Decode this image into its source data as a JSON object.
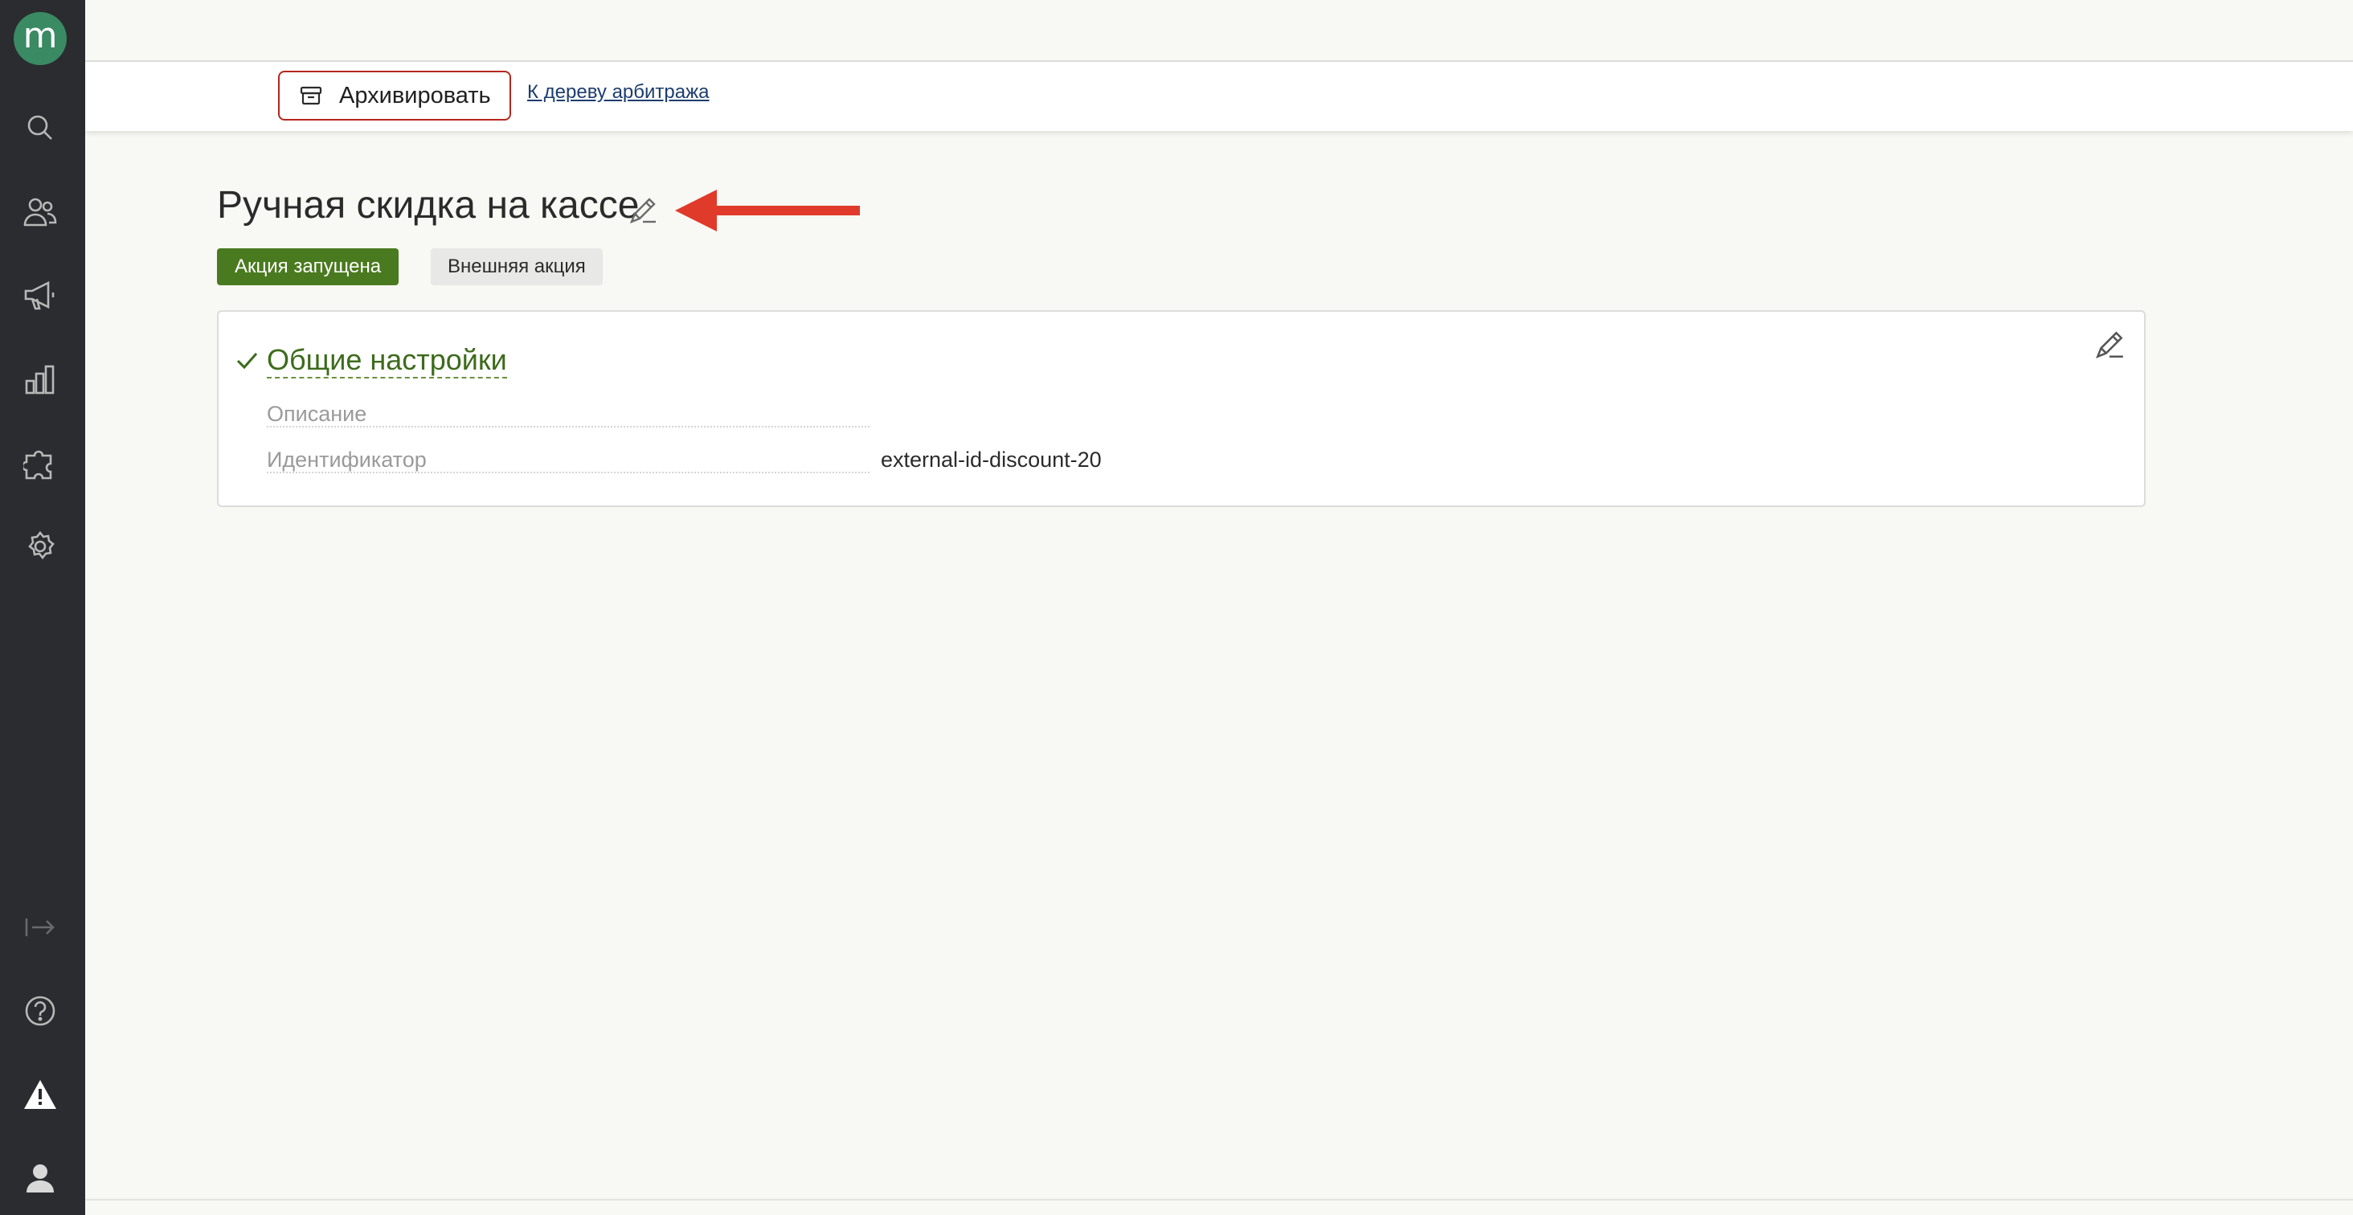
{
  "colors": {
    "sidebar_bg": "#2a2c30",
    "logo_bg": "#3a8a63",
    "active_badge": "#4a7a1f",
    "archive_border": "#b5261e",
    "section_title": "#3d6b1c",
    "arrow": "#e03a2a"
  },
  "sidebar": {
    "logo_letter": "m",
    "items": [
      {
        "icon": "search-icon"
      },
      {
        "icon": "users-icon"
      },
      {
        "icon": "megaphone-icon"
      },
      {
        "icon": "bar-chart-icon"
      },
      {
        "icon": "puzzle-icon"
      },
      {
        "icon": "gear-icon"
      }
    ],
    "bottom_items": [
      {
        "icon": "collapse-sidebar-icon"
      },
      {
        "icon": "help-icon"
      },
      {
        "icon": "warning-icon"
      },
      {
        "icon": "user-icon"
      }
    ]
  },
  "toolbar": {
    "archive_label": "Архивировать",
    "tree_link": "К дереву арбитража"
  },
  "page": {
    "title": "Ручная скидка на кассе",
    "badges": {
      "status": "Акция запущена",
      "type": "Внешняя акция"
    }
  },
  "general_settings": {
    "title": "Общие настройки",
    "fields": [
      {
        "label": "Описание",
        "value": ""
      },
      {
        "label": "Идентификатор",
        "value": "external-id-discount-20"
      }
    ]
  }
}
